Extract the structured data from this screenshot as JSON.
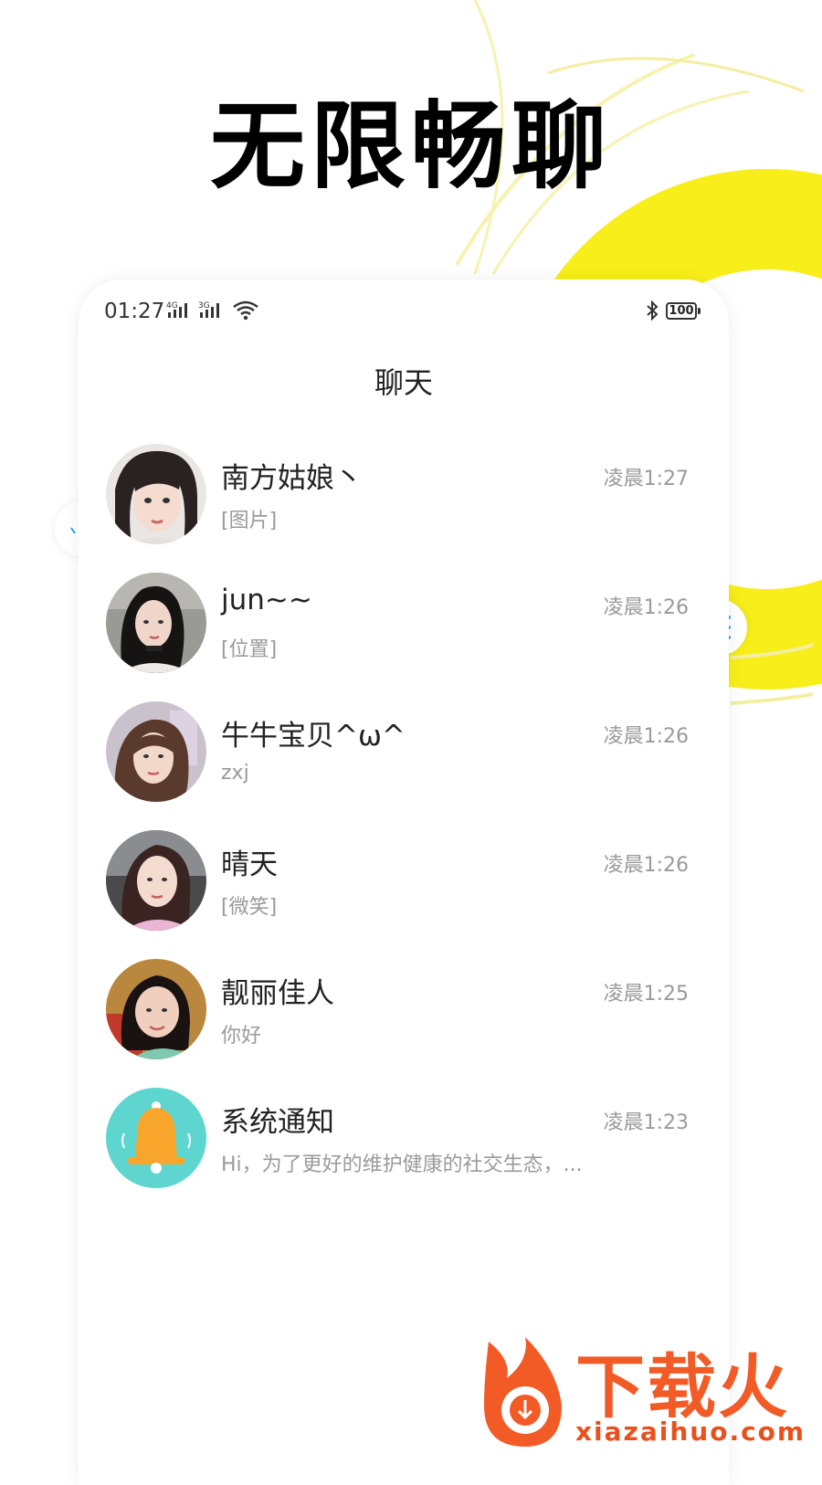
{
  "headline": "无限畅聊",
  "status_bar": {
    "time": "01:27",
    "network_1": "4G",
    "network_2": "3G",
    "battery": "100",
    "icons": [
      "signal-icon",
      "wifi-icon",
      "bluetooth-icon",
      "battery-icon"
    ]
  },
  "page_title": "聊天",
  "chats": [
    {
      "name": "南方姑娘丶",
      "preview": "[图片]",
      "time": "凌晨1:27"
    },
    {
      "name": "jun~~",
      "preview": "[位置]",
      "time": "凌晨1:26"
    },
    {
      "name": "牛牛宝贝^ω^",
      "preview": "zxj",
      "time": "凌晨1:26"
    },
    {
      "name": "晴天",
      "preview": "[微笑]",
      "time": "凌晨1:26"
    },
    {
      "name": "靓丽佳人",
      "preview": "你好",
      "time": "凌晨1:25"
    },
    {
      "name": "系统通知",
      "preview": "Hi，为了更好的维护健康的社交生态，...",
      "time": "凌晨1:23"
    }
  ],
  "watermark": {
    "brand": "下载火",
    "url": "xiazaihuo.com"
  },
  "colors": {
    "accent_yellow": "#f6ea12",
    "system_avatar": "#5ed6cf",
    "bell": "#f8a52b",
    "watermark": "#f25a26"
  }
}
